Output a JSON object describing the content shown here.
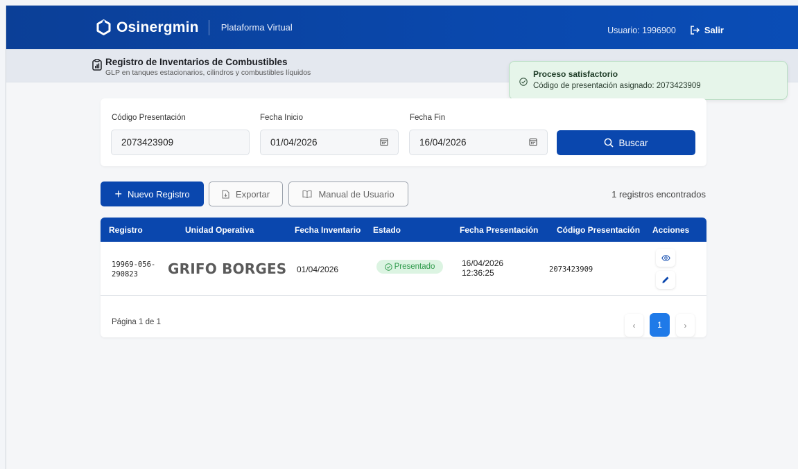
{
  "header": {
    "brand": "Osinergmin",
    "platform": "Plataforma Virtual",
    "user_label": "Usuario: 1996900",
    "logout_label": "Salir"
  },
  "subheader": {
    "title": "Registro de Inventarios de Combustibles",
    "description": "GLP en tanques estacionarios, cilindros y combustibles líquidos"
  },
  "toast": {
    "title": "Proceso satisfactorio",
    "message": "Código de presentación asignado: 2073423909"
  },
  "filters": {
    "codigo_label": "Código Presentación",
    "codigo_value": "2073423909",
    "fecha_inicio_label": "Fecha Inicio",
    "fecha_inicio_value": "01/04/2026",
    "fecha_fin_label": "Fecha Fin",
    "fecha_fin_value": "16/04/2026",
    "search_label": "Buscar"
  },
  "actions": {
    "new_label": "Nuevo Registro",
    "export_label": "Exportar",
    "manual_label": "Manual de Usuario",
    "count_text": "1 registros encontrados"
  },
  "table": {
    "columns": [
      "Registro",
      "Unidad Operativa",
      "Fecha Inventario",
      "Estado",
      "Fecha Presentación",
      "Código Presentación",
      "Acciones"
    ],
    "rows": [
      {
        "registro_line1": "19969-056-",
        "registro_line2": "290823",
        "unidad": "GRIFO BORGES",
        "fecha_inventario": "01/04/2026",
        "estado": "Presentado",
        "fecha_presentacion_date": "16/04/2026",
        "fecha_presentacion_time": "12:36:25",
        "codigo": "2073423909"
      }
    ]
  },
  "pagination": {
    "text": "Página 1 de 1",
    "current": "1",
    "prev": "‹",
    "next": "›"
  },
  "colors": {
    "primary": "#0a47ae",
    "success_bg": "#e6f5ea",
    "badge_text": "#2f9a4b",
    "page_active": "#1f7ae8"
  }
}
